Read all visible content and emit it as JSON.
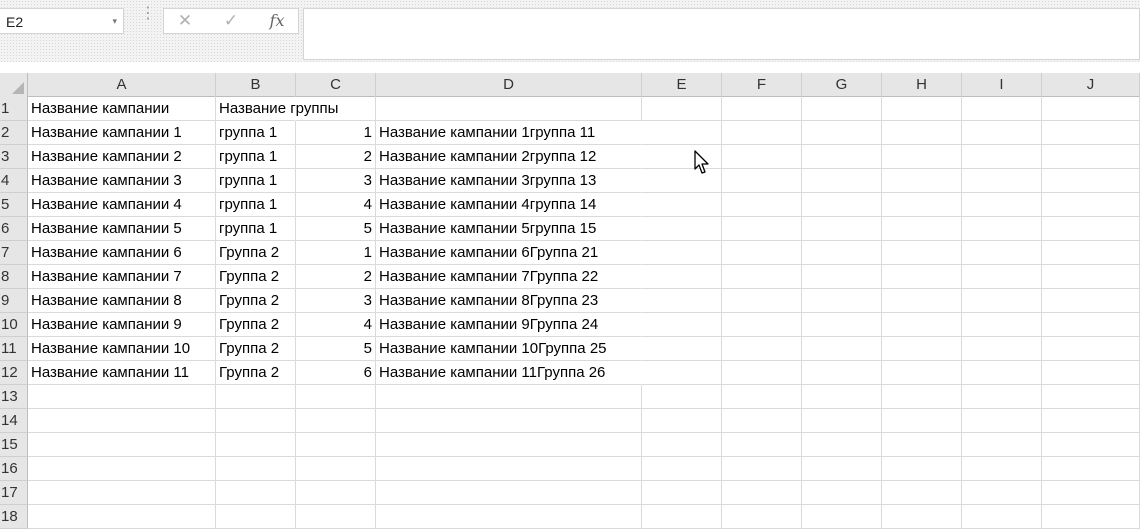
{
  "namebox": {
    "value": "E2",
    "arrow": "▾"
  },
  "formula_bar": {
    "cancel_glyph": "✕",
    "enter_glyph": "✓",
    "fx_label": "fx",
    "value": ""
  },
  "columns": [
    "A",
    "B",
    "C",
    "D",
    "E",
    "F",
    "G",
    "H",
    "I",
    "J"
  ],
  "row_numbers": [
    "1",
    "2",
    "3",
    "4",
    "5",
    "6",
    "7",
    "8",
    "9",
    "10",
    "11",
    "12",
    "13",
    "14",
    "15",
    "16",
    "17",
    "18"
  ],
  "cells": [
    [
      "Название кампании",
      "Название группы",
      "",
      "",
      "",
      "",
      "",
      "",
      "",
      ""
    ],
    [
      "Название кампании 1",
      "группа 1",
      "1",
      "Название кампании 1группа 11",
      "",
      "",
      "",
      "",
      "",
      ""
    ],
    [
      "Название кампании 2",
      "группа 1",
      "2",
      "Название кампании 2группа 12",
      "",
      "",
      "",
      "",
      "",
      ""
    ],
    [
      "Название кампании 3",
      "группа 1",
      "3",
      "Название кампании 3группа 13",
      "",
      "",
      "",
      "",
      "",
      ""
    ],
    [
      "Название кампании 4",
      "группа 1",
      "4",
      "Название кампании 4группа 14",
      "",
      "",
      "",
      "",
      "",
      ""
    ],
    [
      "Название кампании 5",
      "группа 1",
      "5",
      "Название кампании 5группа 15",
      "",
      "",
      "",
      "",
      "",
      ""
    ],
    [
      "Название кампании 6",
      "Группа 2",
      "1",
      "Название кампании 6Группа 21",
      "",
      "",
      "",
      "",
      "",
      ""
    ],
    [
      "Название кампании 7",
      "Группа 2",
      "2",
      "Название кампании 7Группа 22",
      "",
      "",
      "",
      "",
      "",
      ""
    ],
    [
      "Название кампании 8",
      "Группа 2",
      "3",
      "Название кампании 8Группа 23",
      "",
      "",
      "",
      "",
      "",
      ""
    ],
    [
      "Название кампании 9",
      "Группа 2",
      "4",
      "Название кампании 9Группа 24",
      "",
      "",
      "",
      "",
      "",
      ""
    ],
    [
      "Название кампании 10",
      "Группа 2",
      "5",
      "Название кампании 10Группа 25",
      "",
      "",
      "",
      "",
      "",
      ""
    ],
    [
      "Название кампании 11",
      "Группа 2",
      "6",
      "Название кампании 11Группа 26",
      "",
      "",
      "",
      "",
      "",
      ""
    ],
    [
      "",
      "",
      "",
      "",
      "",
      "",
      "",
      "",
      "",
      ""
    ],
    [
      "",
      "",
      "",
      "",
      "",
      "",
      "",
      "",
      "",
      ""
    ],
    [
      "",
      "",
      "",
      "",
      "",
      "",
      "",
      "",
      "",
      ""
    ],
    [
      "",
      "",
      "",
      "",
      "",
      "",
      "",
      "",
      "",
      ""
    ],
    [
      "",
      "",
      "",
      "",
      "",
      "",
      "",
      "",
      "",
      ""
    ],
    [
      "",
      "",
      "",
      "",
      "",
      "",
      "",
      "",
      "",
      ""
    ]
  ],
  "colors": {
    "header_bg": "#e6e6e6",
    "gridline": "#dadada"
  }
}
